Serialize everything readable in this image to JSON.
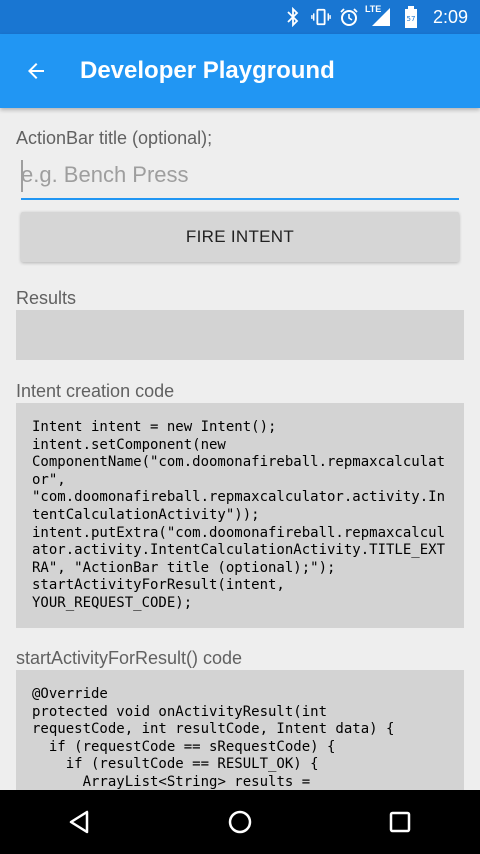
{
  "status_bar": {
    "time": "2:09",
    "network_label": "LTE",
    "icons": [
      "bluetooth-icon",
      "vibrate-icon",
      "alarm-icon",
      "signal-icon",
      "battery-icon"
    ]
  },
  "app_bar": {
    "title": "Developer Playground",
    "back_icon": "arrow-back-icon"
  },
  "form": {
    "title_label": "ActionBar title (optional);",
    "title_placeholder": "e.g. Bench Press",
    "title_value": "",
    "fire_button": "FIRE INTENT"
  },
  "results": {
    "label": "Results",
    "value": ""
  },
  "intent_code": {
    "label": "Intent creation code",
    "code": "Intent intent = new Intent();\nintent.setComponent(new\nComponentName(\"com.doomonafireball.repmaxcalculator\",\n\"com.doomonafireball.repmaxcalculator.activity.IntentCalculationActivity\"));\nintent.putExtra(\"com.doomonafireball.repmaxcalculator.activity.IntentCalculationActivity.TITLE_EXTRA\", \"ActionBar title (optional);\");\nstartActivityForResult(intent,\nYOUR_REQUEST_CODE);"
  },
  "result_code": {
    "label": "startActivityForResult() code",
    "code": "@Override\nprotected void onActivityResult(int\nrequestCode, int resultCode, Intent data) {\n  if (requestCode == sRequestCode) {\n    if (resultCode == RESULT_OK) {\n      ArrayList<String> results ="
  },
  "nav_bar": {
    "icons": [
      "back-triangle-icon",
      "home-circle-icon",
      "recents-square-icon"
    ]
  },
  "colors": {
    "primary": "#2196f3",
    "primary_dark": "#1976d2",
    "code_background": "#d3d3d3",
    "page_background": "#eeeeee"
  }
}
